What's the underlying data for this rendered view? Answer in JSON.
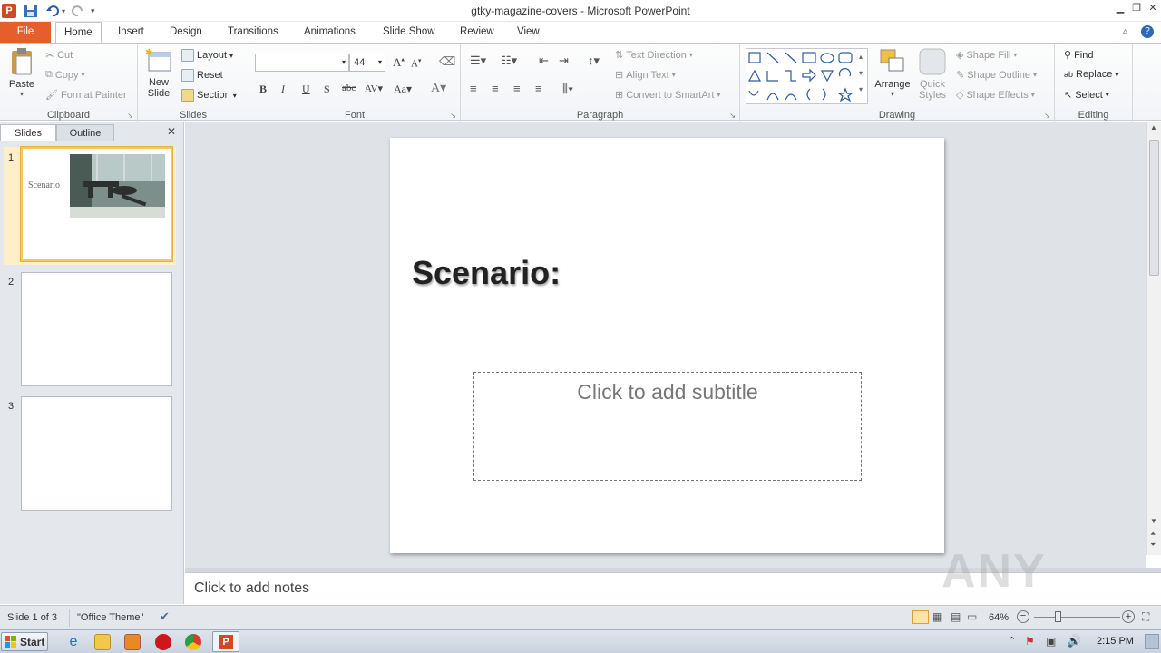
{
  "window": {
    "title": "gtky-magazine-covers - Microsoft PowerPoint"
  },
  "tabs": {
    "file": "File",
    "home": "Home",
    "insert": "Insert",
    "design": "Design",
    "transitions": "Transitions",
    "animations": "Animations",
    "slideshow": "Slide Show",
    "review": "Review",
    "view": "View"
  },
  "clipboard": {
    "label": "Clipboard",
    "paste": "Paste",
    "cut": "Cut",
    "copy": "Copy",
    "format_painter": "Format Painter"
  },
  "slides_group": {
    "label": "Slides",
    "new_slide_1": "New",
    "new_slide_2": "Slide",
    "layout": "Layout",
    "reset": "Reset",
    "section": "Section"
  },
  "font": {
    "label": "Font",
    "size": "44",
    "name": ""
  },
  "paragraph": {
    "label": "Paragraph",
    "text_direction": "Text Direction",
    "align_text": "Align Text",
    "smartart": "Convert to SmartArt"
  },
  "drawing": {
    "label": "Drawing",
    "arrange": "Arrange",
    "quick_1": "Quick",
    "quick_2": "Styles",
    "shape_fill": "Shape Fill",
    "shape_outline": "Shape Outline",
    "shape_effects": "Shape Effects"
  },
  "editing": {
    "label": "Editing",
    "find": "Find",
    "replace": "Replace",
    "select": "Select"
  },
  "pane": {
    "slides_tab": "Slides",
    "outline_tab": "Outline",
    "thumbs": [
      {
        "num": "1",
        "text": "Scenario"
      },
      {
        "num": "2",
        "text": ""
      },
      {
        "num": "3",
        "text": ""
      }
    ]
  },
  "slide": {
    "title": "Scenario:",
    "subtitle_placeholder": "Click to add subtitle"
  },
  "notes": {
    "placeholder": "Click to add notes"
  },
  "status": {
    "slide_info": "Slide 1 of 3",
    "theme": "\"Office Theme\"",
    "zoom": "64%"
  },
  "taskbar": {
    "start": "Start",
    "time": "2:15 PM"
  },
  "watermark": "ANY RUN"
}
